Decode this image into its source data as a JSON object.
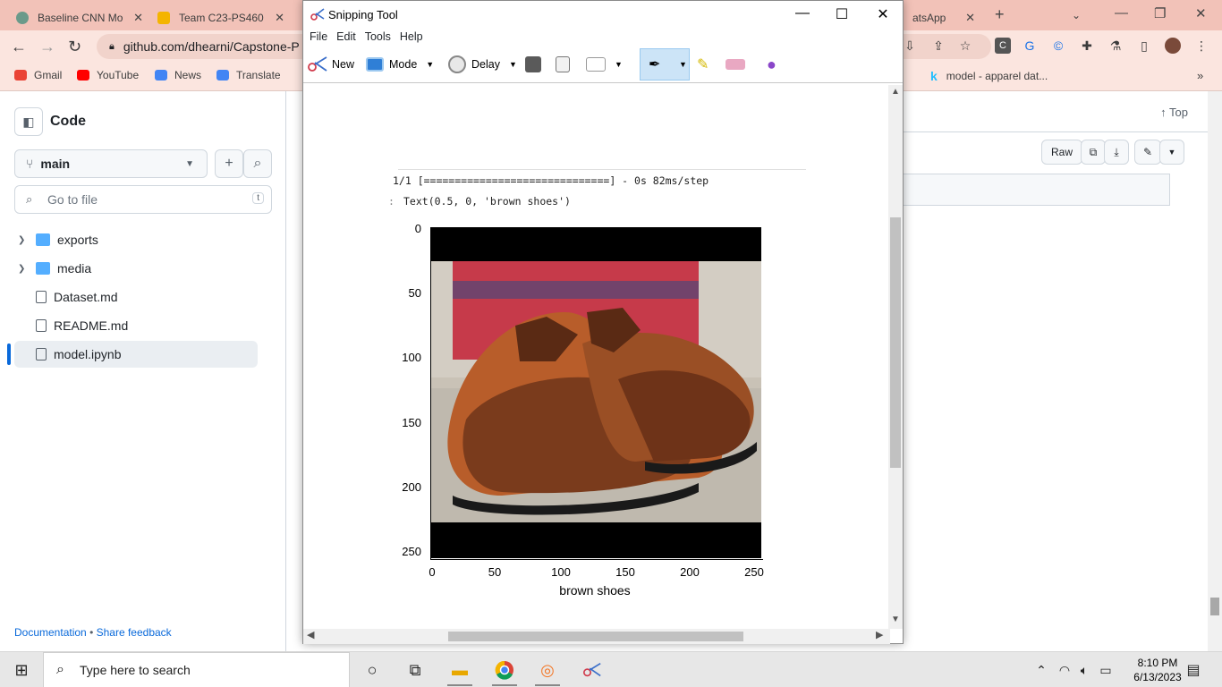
{
  "browser": {
    "tabs": [
      {
        "title": "Baseline CNN Mo"
      },
      {
        "title": "Team C23-PS460"
      },
      {
        "title": "atsApp"
      }
    ],
    "url": "github.com/dhearni/Capstone-P",
    "bookmarks": [
      "Gmail",
      "YouTube",
      "News",
      "Translate"
    ],
    "bookmark_right": "model - apparel dat..."
  },
  "github": {
    "code_title": "Code",
    "branch": "main",
    "goto_placeholder": "Go to file",
    "goto_key": "t",
    "tree": [
      {
        "name": "exports",
        "type": "folder"
      },
      {
        "name": "media",
        "type": "folder"
      },
      {
        "name": "Dataset.md",
        "type": "file"
      },
      {
        "name": "README.md",
        "type": "file"
      },
      {
        "name": "model.ipynb",
        "type": "file",
        "selected": true
      }
    ],
    "footer_doc": "Documentation",
    "footer_sep": "•",
    "footer_feedback": "Share feedback",
    "top_label": "Top",
    "raw_label": "Raw"
  },
  "snipping_tool": {
    "title": "Snipping Tool",
    "menu": [
      "File",
      "Edit",
      "Tools",
      "Help"
    ],
    "tools": {
      "new": "New",
      "mode": "Mode",
      "delay": "Delay"
    },
    "output_line1": "1/1 [==============================] - 0s 82ms/step",
    "output_prompt": ":",
    "output_line2": "Text(0.5, 0, 'brown shoes')",
    "plot": {
      "xlabel": "brown shoes",
      "xticks": [
        "0",
        "50",
        "100",
        "150",
        "200",
        "250"
      ],
      "yticks": [
        "0",
        "50",
        "100",
        "150",
        "200",
        "250"
      ]
    }
  },
  "taskbar": {
    "search_placeholder": "Type here to search",
    "time": "8:10 PM",
    "date": "6/13/2023"
  }
}
